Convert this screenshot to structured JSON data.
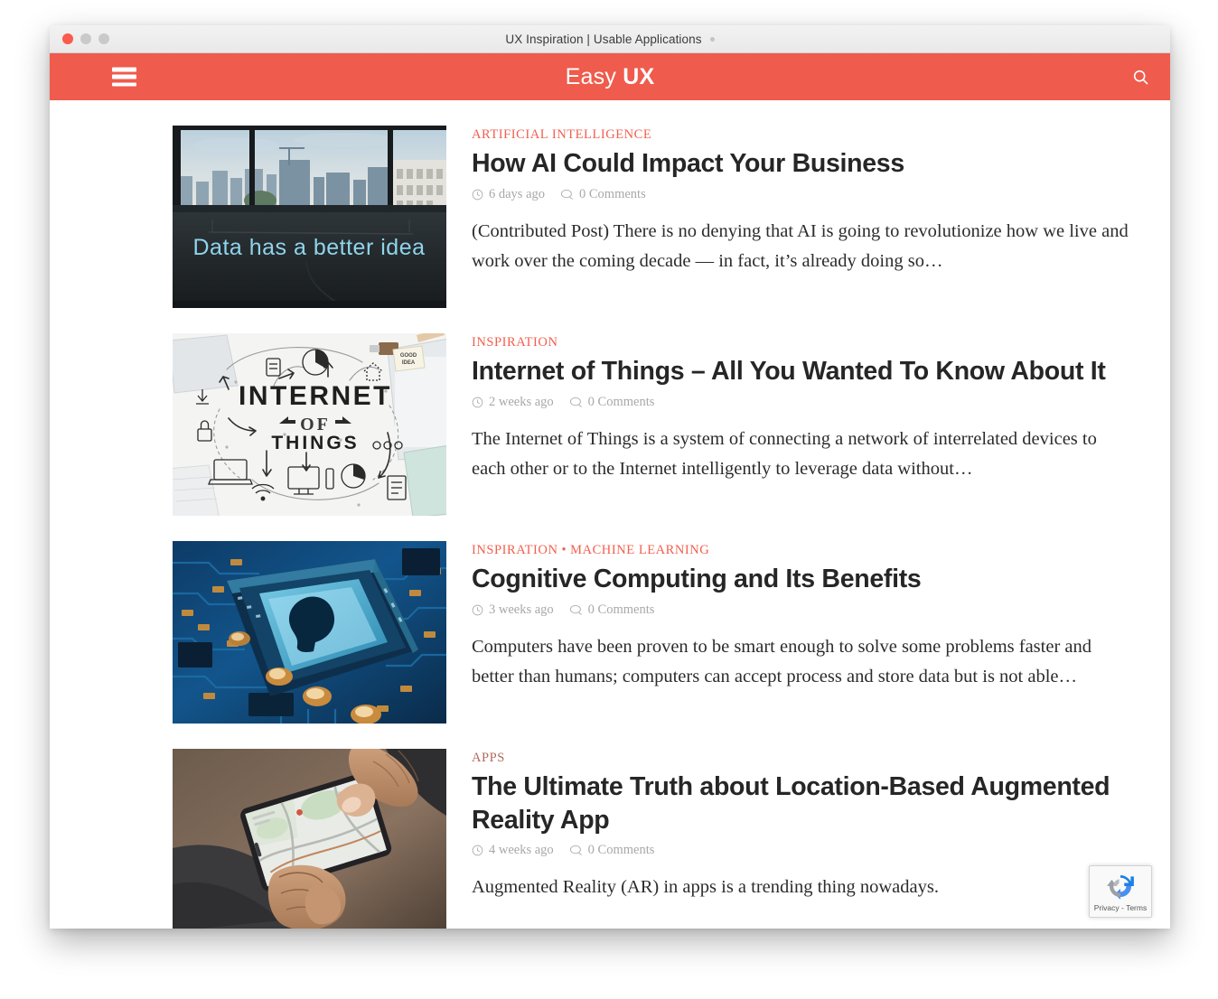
{
  "window": {
    "tab_title": "UX Inspiration | Usable Applications",
    "traffic_lights": [
      "close-red",
      "minimize-gray",
      "maximize-gray"
    ]
  },
  "header": {
    "menu_icon": "hamburger-menu-icon",
    "logo_light": "Easy",
    "logo_bold": "UX",
    "search_icon": "search-icon",
    "background_color": "#ef5b4c"
  },
  "colors": {
    "accent": "#ef5b4c",
    "category_link": "#f0604f",
    "category_muted": "#b06a5e",
    "title": "#262626",
    "meta": "#a8a8a8",
    "body_text": "#2c2c2c"
  },
  "posts": [
    {
      "categories": [
        "ARTIFICIAL INTELLIGENCE"
      ],
      "muted_category": false,
      "title": "How AI Could Impact Your Business",
      "date": "6 days ago",
      "comments": "0 Comments",
      "excerpt": "(Contributed Post) There is no denying that AI is going to revolutionize how we live and work over the coming decade — in fact, it’s already doing so…",
      "image_alt": "city-skyline-through-window-with-neon-sign",
      "image_caption": "Data has a better idea"
    },
    {
      "categories": [
        "INSPIRATION"
      ],
      "muted_category": false,
      "title": "Internet of Things – All You Wanted To Know About It",
      "date": "2 weeks ago",
      "comments": "0 Comments",
      "excerpt": "The Internet of Things is a system of connecting a network of interrelated devices to each other or to the Internet intelligently to leverage data without…",
      "image_alt": "internet-of-things-doodle-illustration",
      "image_caption": "INTERNET OF THINGS"
    },
    {
      "categories": [
        "INSPIRATION",
        "MACHINE LEARNING"
      ],
      "muted_category": false,
      "title": "Cognitive Computing and Its Benefits",
      "date": "3 weeks ago",
      "comments": "0 Comments",
      "excerpt": "Computers have been proven to be smart enough to solve some problems faster and better than humans; computers can accept process and store data but is not able…",
      "image_alt": "blue-circuit-board-with-brain-head-chip",
      "image_caption": ""
    },
    {
      "categories": [
        "APPS"
      ],
      "muted_category": true,
      "title": "The Ultimate Truth about Location-Based Augmented Reality App",
      "date": "4 weeks ago",
      "comments": "0 Comments",
      "excerpt": "Augmented Reality (AR) in apps is a trending thing nowadays.",
      "image_alt": "hands-holding-smartphone-with-map-app",
      "image_caption": ""
    }
  ],
  "recaptcha": {
    "label": "Privacy - Terms",
    "logo_icon": "recaptcha-logo-icon"
  },
  "icons": {
    "clock": "clock-icon",
    "comment": "comment-bubble-icon",
    "category_separator": "•"
  }
}
